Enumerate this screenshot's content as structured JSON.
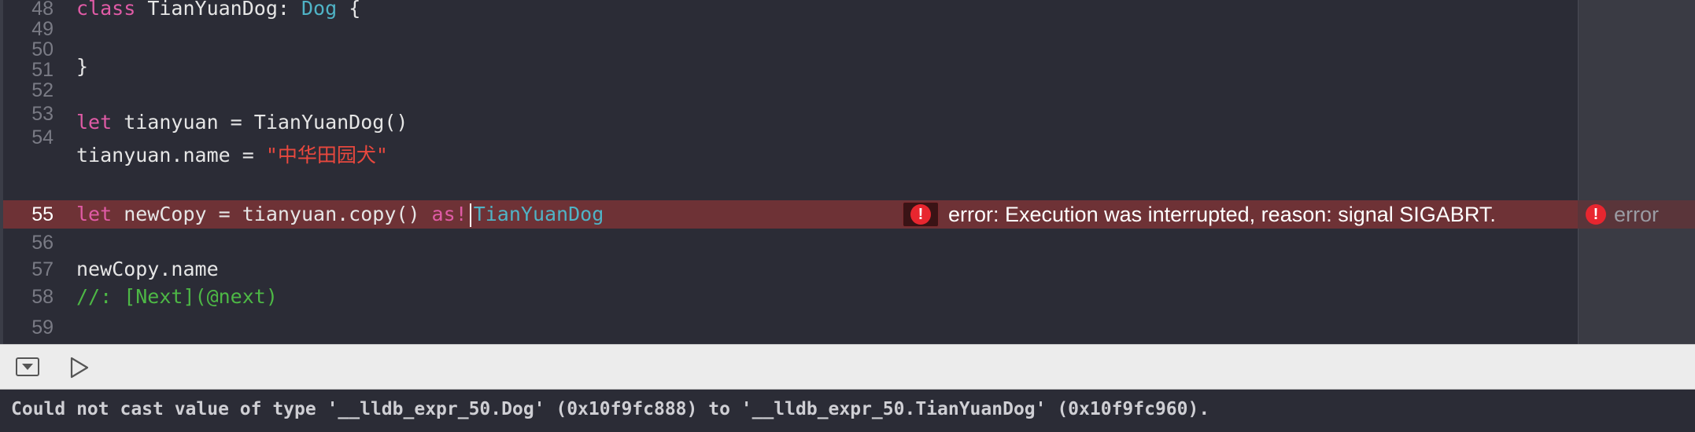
{
  "editor": {
    "line_numbers": [
      "48",
      "49",
      "50",
      "51",
      "52",
      "53",
      "54",
      "55",
      "56",
      "57",
      "58",
      "59"
    ],
    "current_line": "55",
    "lines": {
      "l48": {
        "kw": "class",
        "name": " TianYuanDog: ",
        "type": "Dog",
        "rest": " {"
      },
      "l50": {
        "text": "}"
      },
      "l52": {
        "kw": "let",
        "rest": " tianyuan = TianYuanDog()"
      },
      "l53": {
        "lhs": "tianyuan.name = ",
        "str": "\"中华田园犬\""
      },
      "l55": {
        "kw": "let",
        "mid": " newCopy = tianyuan.copy() ",
        "kw2": "as!",
        "type": "TianYuanDog"
      },
      "l57": {
        "text": "newCopy.name"
      },
      "l58": {
        "comment": "//: [Next](@next)"
      }
    },
    "error_message": "error: Execution was interrupted, reason: signal SIGABRT.",
    "error_badge_glyph": "!"
  },
  "results": {
    "error_label": "error",
    "error_glyph": "!"
  },
  "debug_bar": {
    "hide_icon": "hide-debug-area-icon",
    "run_icon": "play-icon"
  },
  "console": {
    "output": "Could not cast value of type '__lldb_expr_50.Dog' (0x10f9fc888) to '__lldb_expr_50.TianYuanDog' (0x10f9fc960)."
  },
  "colors": {
    "editor_bg": "#2b2c36",
    "keyword": "#e05ba6",
    "type": "#4fb3c6",
    "string": "#e8483e",
    "comment": "#4db845",
    "error_line_bg": "#6e3236",
    "error_red": "#e8262f"
  }
}
